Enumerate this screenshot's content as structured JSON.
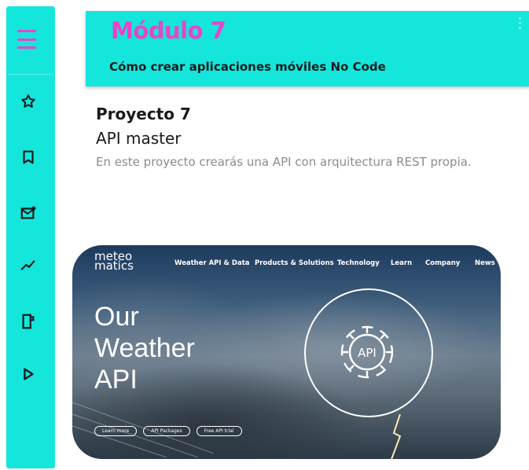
{
  "sidebar": {
    "menu_icon": "hamburger-menu-icon",
    "items": [
      {
        "icon": "star-icon"
      },
      {
        "icon": "bookmark-icon"
      },
      {
        "icon": "mail-notification-icon"
      },
      {
        "icon": "trend-chart-icon"
      },
      {
        "icon": "document-edit-icon"
      },
      {
        "icon": "play-icon"
      }
    ]
  },
  "module": {
    "title": "Módulo 7",
    "subtitle": "Cómo crear aplicaciones móviles No Code"
  },
  "project": {
    "title": "Proyecto 7",
    "name": "API master",
    "description": "En este proyecto crearás una API con arquitectura REST propia."
  },
  "preview": {
    "logo_top": "meteo",
    "logo_bottom": "matics",
    "nav": [
      "Weather API & Data",
      "Products & Solutions",
      "Technology",
      "Learn",
      "Company",
      "News"
    ],
    "hero": [
      "Our",
      "Weather",
      "API"
    ],
    "badge": "API",
    "buttons": [
      "Learn more",
      "API Packages",
      "Free API trial"
    ]
  },
  "colors": {
    "accent": "#14e6dc",
    "brand_pink": "#e845c8"
  }
}
